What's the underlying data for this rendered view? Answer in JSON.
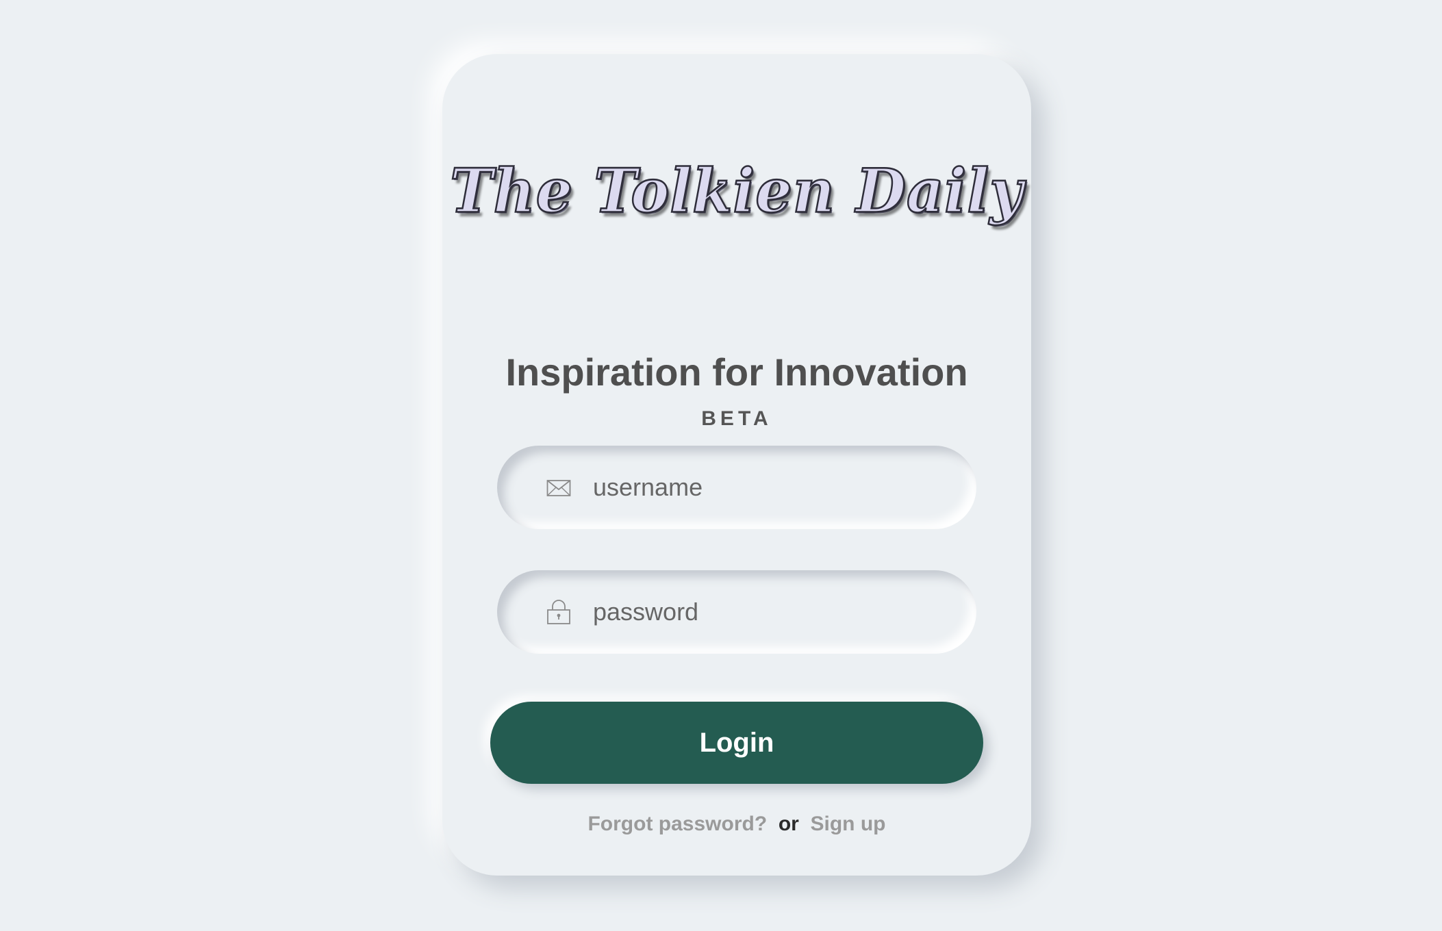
{
  "logo": {
    "text": "The Tolkien Daily"
  },
  "header": {
    "title": "Inspiration for Innovation",
    "badge": "BETA"
  },
  "form": {
    "username": {
      "placeholder": "username",
      "value": "",
      "icon": "mail-icon"
    },
    "password": {
      "placeholder": "password",
      "value": "",
      "icon": "lock-icon"
    },
    "login_label": "Login"
  },
  "footer": {
    "forgot_label": "Forgot password?",
    "separator": "or",
    "signup_label": "Sign up"
  },
  "colors": {
    "background": "#ecf0f3",
    "accent": "#245c51",
    "title": "#4f4f4f",
    "link": "#9a9a9a"
  }
}
